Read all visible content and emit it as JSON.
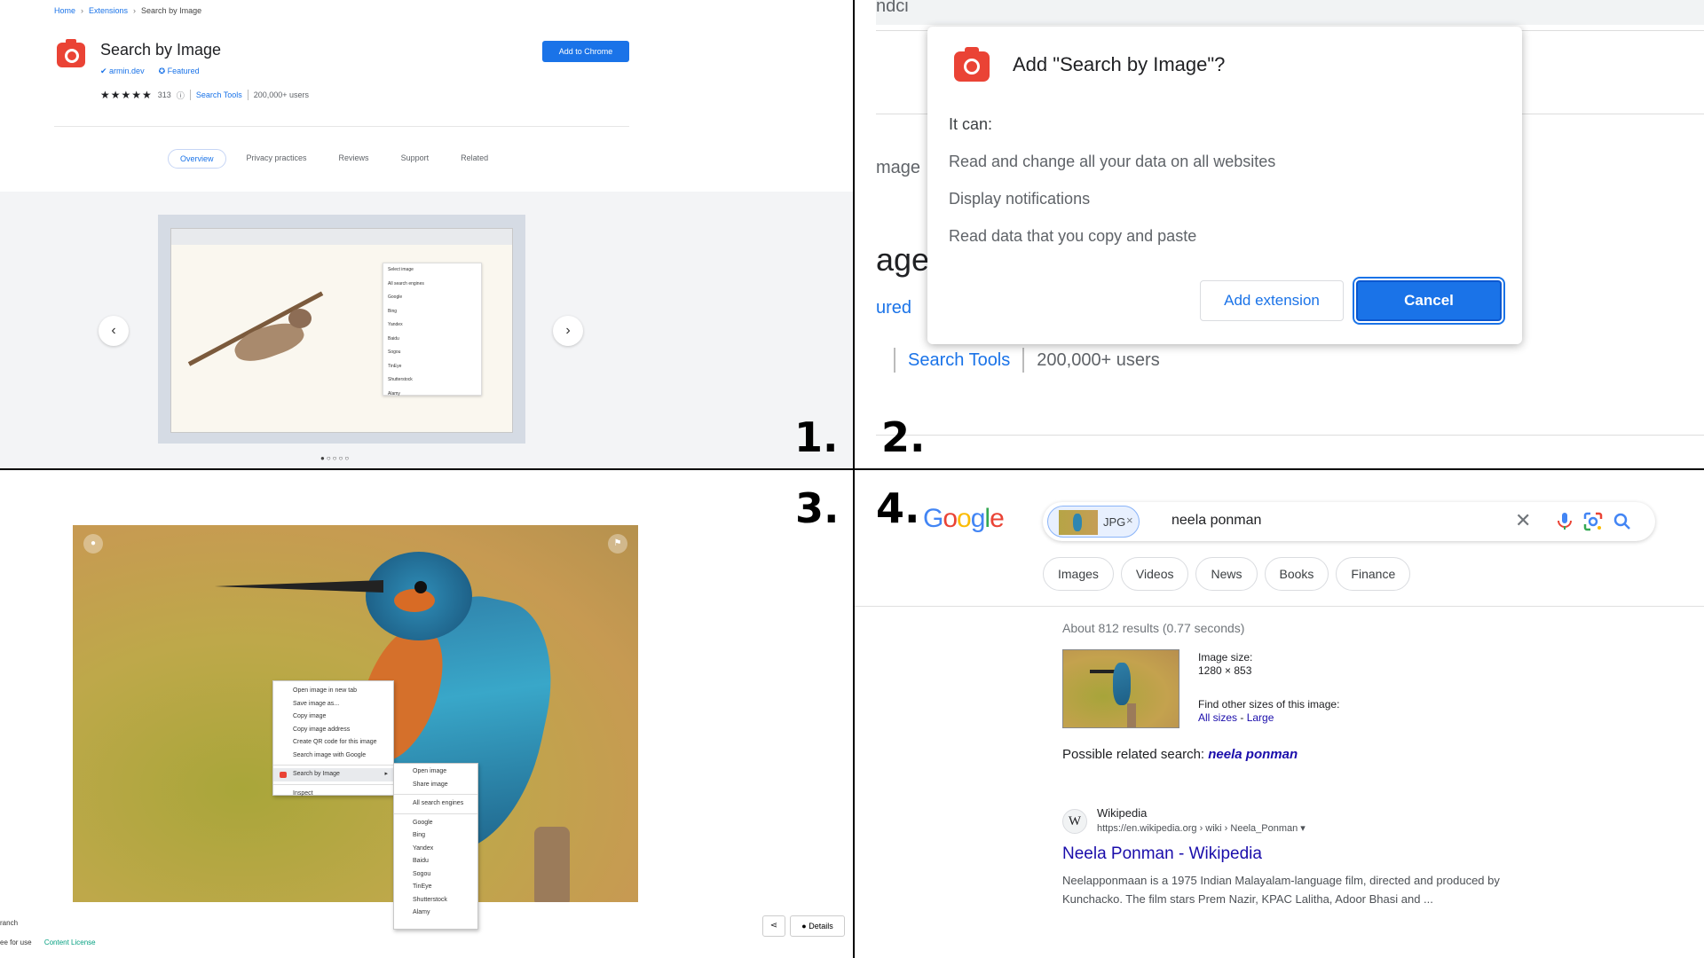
{
  "steps": [
    "1.",
    "2.",
    "3.",
    "4."
  ],
  "panel1": {
    "breadcrumb": [
      "Home",
      "Extensions",
      "Search by Image"
    ],
    "title": "Search by Image",
    "developer": "armin.dev",
    "featured": "Featured",
    "rating_count": "313",
    "category": "Search Tools",
    "users": "200,000+ users",
    "add_button": "Add to Chrome",
    "tabs": [
      "Overview",
      "Privacy practices",
      "Reviews",
      "Support",
      "Related"
    ],
    "active_tab": "Overview",
    "screenshot_menu_title": "Select image",
    "screenshot_menu": [
      "All search engines",
      "Google",
      "Bing",
      "Yandex",
      "Baidu",
      "Sogou",
      "TinEye",
      "Shutterstock",
      "Alamy"
    ],
    "prev_icon": "chevron-left-icon",
    "next_icon": "chevron-right-icon",
    "carousel_dots": "●○○○○"
  },
  "panel2": {
    "bg_text_a": "ndci",
    "bg_text_b": "mage",
    "bg_text_c": "age",
    "bg_text_d": "ured",
    "dialog_title": "Add \"Search by Image\"?",
    "it_can": "It can:",
    "permissions": [
      "Read and change all your data on all websites",
      "Display notifications",
      "Read data that you copy and paste"
    ],
    "add_button": "Add extension",
    "cancel_button": "Cancel",
    "category": "Search Tools",
    "users": "200,000+ users"
  },
  "panel3": {
    "context_menu": [
      "Open image in new tab",
      "Save image as...",
      "Copy image",
      "Copy image address",
      "Create QR code for this image",
      "Search image with Google"
    ],
    "context_highlight": "Search by Image",
    "context_inspect": "Inspect",
    "submenu_top": [
      "Open image",
      "Share image"
    ],
    "submenu_all": "All search engines",
    "submenu_engines": [
      "Google",
      "Bing",
      "Yandex",
      "Baidu",
      "Sogou",
      "TinEye",
      "Shutterstock",
      "Alamy"
    ],
    "bottom_left_a": "ranch",
    "bottom_left_b": "ee for use",
    "content_license": "Content License",
    "details_button": "Details"
  },
  "panel4": {
    "chip_label": "JPG",
    "query": "neela ponman",
    "filters": [
      "Images",
      "Videos",
      "News",
      "Books",
      "Finance"
    ],
    "stats": "About 812 results (0.77 seconds)",
    "image_size_label": "Image size:",
    "image_size_value": "1280 × 853",
    "other_sizes_label": "Find other sizes of this image:",
    "all_sizes": "All sizes",
    "large": "Large",
    "related_label": "Possible related search:",
    "related_query": "neela ponman",
    "result_site": "Wikipedia",
    "result_url": "https://en.wikipedia.org › wiki › Neela_Ponman",
    "result_title": "Neela Ponman - Wikipedia",
    "result_snippet": "Neelapponmaan is a 1975 Indian Malayalam-language film, directed and produced by Kunchacko. The film stars Prem Nazir, KPAC Lalitha, Adoor Bhasi and ..."
  },
  "colors": {
    "accent_blue": "#1a73e8",
    "brand_red": "#ea4335",
    "link_purple": "#1a0dab"
  }
}
